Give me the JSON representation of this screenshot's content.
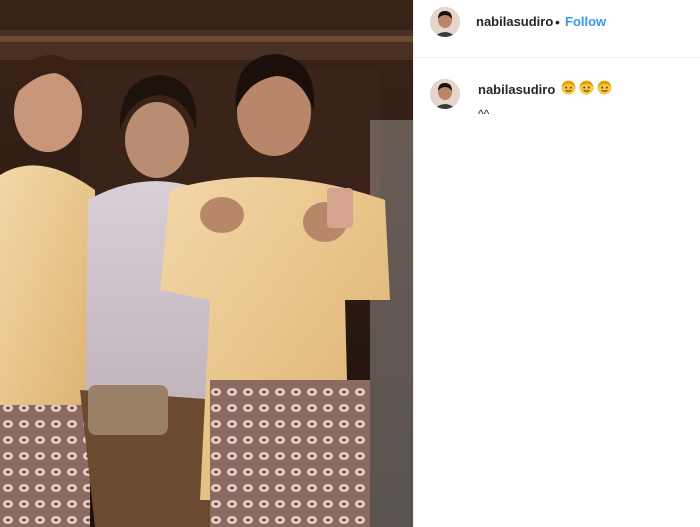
{
  "post": {
    "image_description_icon": "photo",
    "author": "nabilasudiro",
    "follow_separator": "•",
    "follow_label": "Follow"
  },
  "comment": {
    "author": "nabilasudiro",
    "emojis": [
      "face-emoji",
      "face-emoji",
      "face-emoji"
    ],
    "text": "^^"
  },
  "colors": {
    "link": "#3897f0",
    "text": "#262626",
    "divider": "#efefef"
  }
}
